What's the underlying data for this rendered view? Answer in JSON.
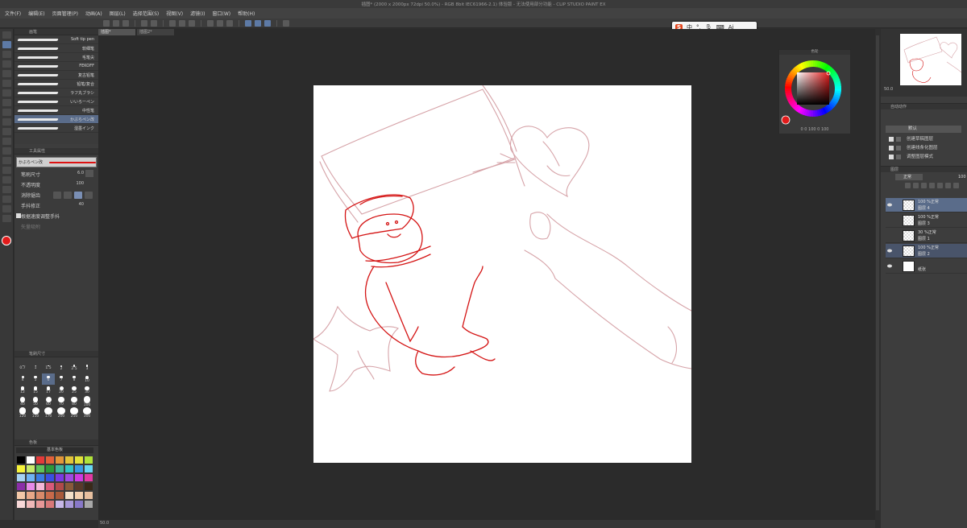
{
  "window": {
    "title": "插图* (2000 x 2000px 72dpi 50.0%) - RGB 8bit IEC61966-2.1) 体验版 - 无法使用部分功能 - CLIP STUDIO PAINT EX"
  },
  "menu": [
    "文件(F)",
    "编辑(E)",
    "页面管理(P)",
    "动画(A)",
    "图层(L)",
    "选择范围(S)",
    "视图(V)",
    "滤镜(I)",
    "窗口(W)",
    "帮助(H)"
  ],
  "ime": {
    "labels": [
      "中",
      "°,",
      "🎙",
      "⌨",
      "Ai"
    ]
  },
  "doc_tabs": [
    "插图*",
    "插图2*"
  ],
  "brush_panel": {
    "tab": "画笔",
    "items": [
      "Soft tip pen",
      "软细笔",
      "毛笔尖",
      "FEKOFF",
      "复古铅笔",
      "铅笔/复合",
      "ラフ丸ブラシ",
      "いいろーペン",
      "中性笔",
      "かぶらペン改",
      "湿墨インク"
    ],
    "selected_index": 9
  },
  "tool_property": {
    "tab": "工具属性",
    "preview_name": "かぶらペン改",
    "size_label": "笔刷尺寸",
    "size_value": "6.0",
    "opacity_label": "不透明度",
    "opacity_value": "100",
    "aa_label": "消除锯齿",
    "stabilizer_label": "手抖修正",
    "stabilizer_value": "40",
    "speed_label": "根据速度调整手抖",
    "vector_label": "矢量吸附"
  },
  "brush_size": {
    "tab": "笔刷尺寸",
    "sizes": [
      "0.7",
      "1",
      "1.5",
      "2",
      "2.5",
      "3",
      "4",
      "5",
      "6",
      "7",
      "8",
      "10",
      "12",
      "15",
      "17",
      "20",
      "25",
      "30",
      "40",
      "50",
      "60",
      "70",
      "80",
      "100",
      "120",
      "150",
      "170",
      "200",
      "250",
      "300"
    ],
    "selected": "6"
  },
  "color_set": {
    "tab": "色板",
    "name": "基本色板",
    "colors": [
      "#000000",
      "#ffffff",
      "#e23a3a",
      "#e2603a",
      "#e2963a",
      "#e2c43a",
      "#e2e23a",
      "#b0e23a",
      "#f7f33a",
      "#c7e96a",
      "#5fc35a",
      "#2c9a3a",
      "#41b59a",
      "#33c4c4",
      "#3a9ae2",
      "#67d6f3",
      "#a7d3f3",
      "#6fb3f3",
      "#3a7be2",
      "#3a4fe2",
      "#7a3ae2",
      "#a04ae2",
      "#d03ae2",
      "#e23aa4",
      "#8a2fa8",
      "#e68ae8",
      "#f4b8d8",
      "#d85a7a",
      "#b04a4a",
      "#8a5a3a",
      "#5a3a2a",
      "#3a2a1a",
      "#f3c8a8",
      "#e8a888",
      "#d88a6a",
      "#c86a4a",
      "#a85a3a",
      "#f3e0c8",
      "#f3d0b0",
      "#e8c0a0",
      "#f8d8d8",
      "#f0b8b8",
      "#e89898",
      "#d87878",
      "#c8b8e8",
      "#a898d8",
      "#8878c8",
      "#a8a8a8"
    ]
  },
  "color_wheel": {
    "tab": "色轮",
    "readout": "0  0  100  0  100",
    "main_color": "#e21b1b"
  },
  "navigator": {
    "zoom": "50.0"
  },
  "auto_actions": {
    "tab": "自动动作",
    "dropdown": "默认",
    "items": [
      "创建草稿图层",
      "创建线条化图层",
      "调整图层模式"
    ]
  },
  "layers": {
    "tab": "图层",
    "blend": "正常",
    "opacity": "100",
    "rows": [
      {
        "pct": "100 %正常",
        "name": "图层 4",
        "thumb": "transparent",
        "state": "selected"
      },
      {
        "pct": "100 %正常",
        "name": "图层 3",
        "thumb": "transparent",
        "state": "normal"
      },
      {
        "pct": "30 %正常",
        "name": "图层 1",
        "thumb": "transparent",
        "state": "normal"
      },
      {
        "pct": "100 %正常",
        "name": "图层 2",
        "thumb": "transparent",
        "state": "highlight"
      },
      {
        "pct": "",
        "name": "纸张",
        "thumb": "paper",
        "state": "normal"
      }
    ]
  },
  "status": {
    "zoom": "50.0"
  },
  "colors": {
    "accent": "#5d7aa6",
    "ink_red": "#d41414",
    "sketch_pink": "#d6a3a8"
  }
}
